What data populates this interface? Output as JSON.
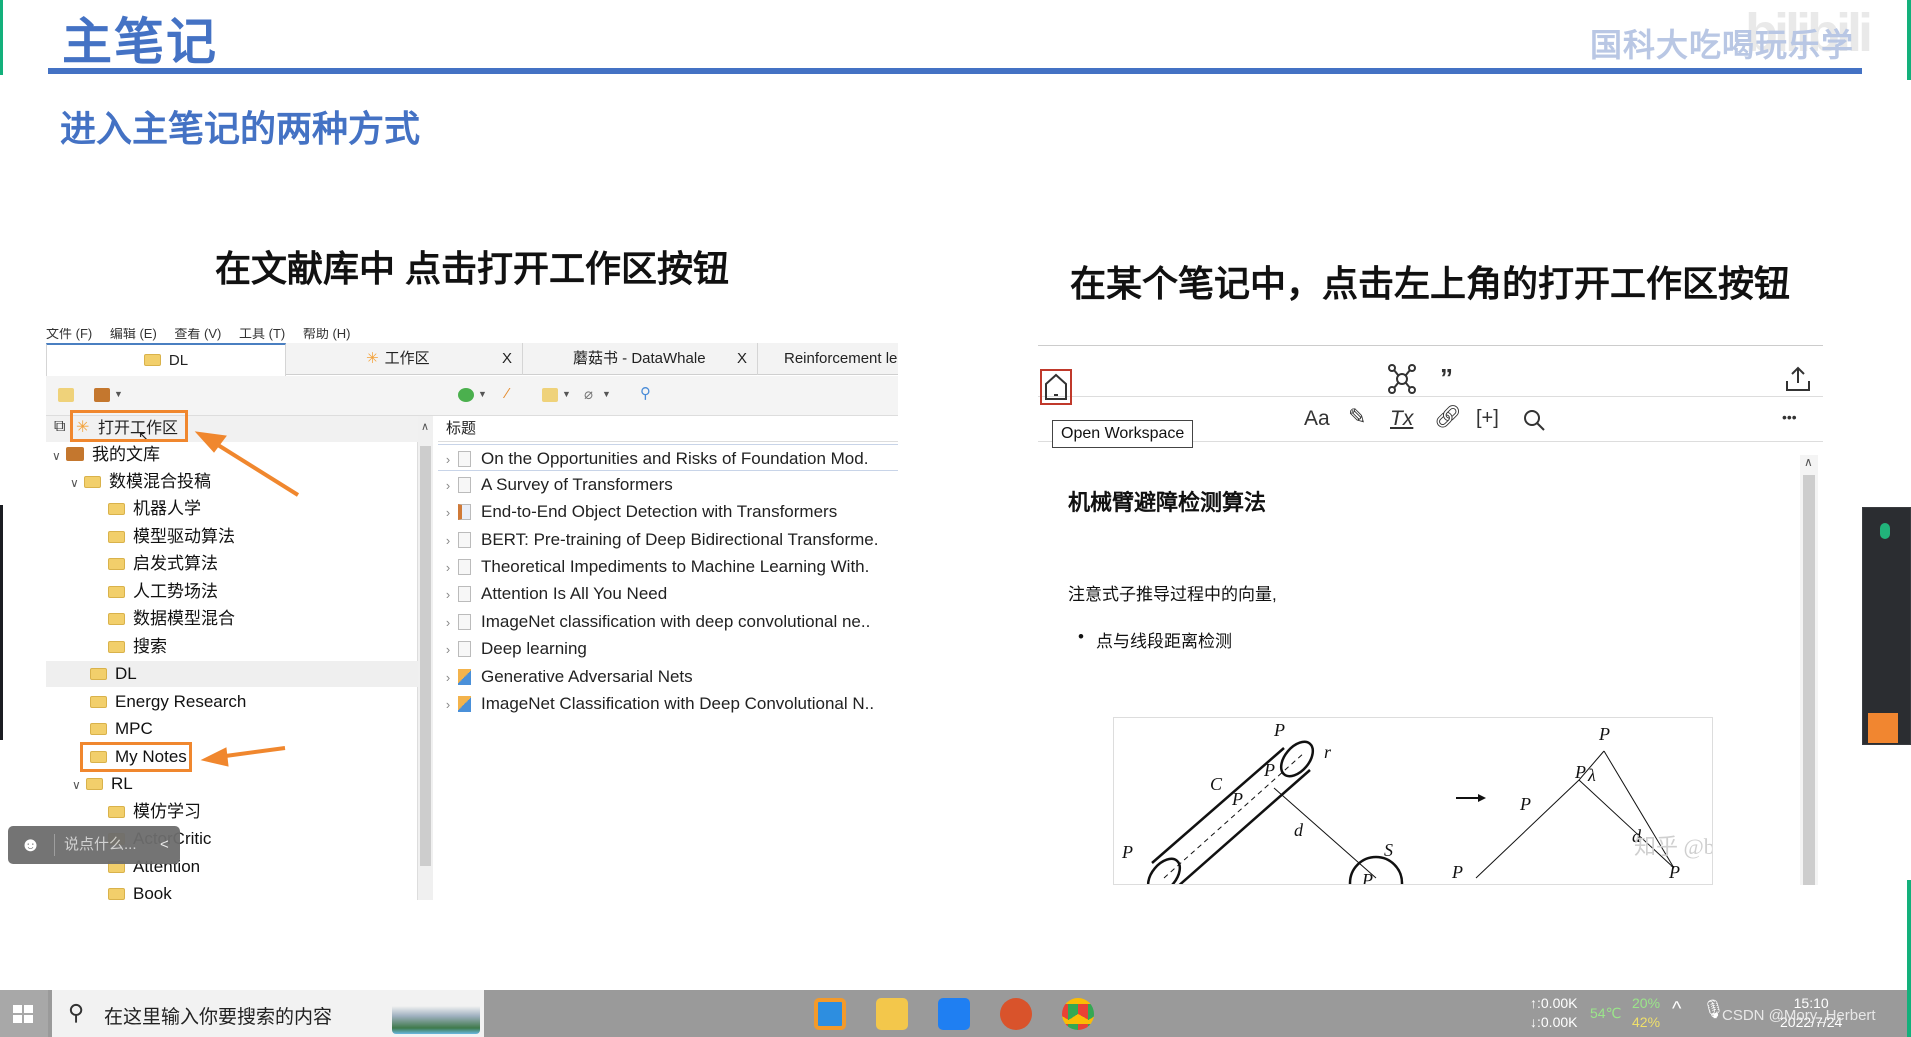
{
  "slide": {
    "title": "主笔记",
    "watermark": "国科大吃喝玩乐学",
    "watermark_logo": "bilibili",
    "subtitle": "进入主笔记的两种方式",
    "caption_left": "在文献库中 点击打开工作区按钮",
    "caption_right": "在某个笔记中，点击左上角的打开工作区按钮",
    "accent_color": "#4472c4",
    "annotation_color": "#f0872e",
    "arrow_color_right": "#e03a2f"
  },
  "zotero": {
    "menu": [
      "文件 (F)",
      "编辑 (E)",
      "查看 (V)",
      "工具 (T)",
      "帮助 (H)"
    ],
    "tabs": [
      {
        "label": "DL",
        "icon": "folder-icon",
        "closable": false,
        "active": true
      },
      {
        "label": "工作区",
        "icon": "workspace-icon",
        "closable": true
      },
      {
        "label": "蘑菇书 - DataWhale",
        "closable": true
      },
      {
        "label": "Reinforcement le",
        "closable": false
      }
    ],
    "close_glyph": "X",
    "open_workspace_label": "打开工作区",
    "tree": [
      {
        "label": "我的文库",
        "level": 0,
        "expanded": true,
        "type": "library"
      },
      {
        "label": "数模混合投稿",
        "level": 1,
        "expanded": true
      },
      {
        "label": "机器人学",
        "level": 2
      },
      {
        "label": "模型驱动算法",
        "level": 2
      },
      {
        "label": "启发式算法",
        "level": 2
      },
      {
        "label": "人工势场法",
        "level": 2
      },
      {
        "label": "数据模型混合",
        "level": 2
      },
      {
        "label": "搜索",
        "level": 2
      },
      {
        "label": "DL",
        "level": 1,
        "selected": true
      },
      {
        "label": "Energy Research",
        "level": 1
      },
      {
        "label": "MPC",
        "level": 1
      },
      {
        "label": "My Notes",
        "level": 1,
        "highlighted": true
      },
      {
        "label": "RL",
        "level": 1,
        "expanded": true
      },
      {
        "label": "模仿学习",
        "level": 2
      },
      {
        "label": "ActorCritic",
        "level": 2
      },
      {
        "label": "Attention",
        "level": 2
      },
      {
        "label": "Book",
        "level": 2
      }
    ],
    "column_header": "标题",
    "items": [
      {
        "title": "On the Opportunities and Risks of Foundation Mod.",
        "type": "doc"
      },
      {
        "title": "A Survey of Transformers",
        "type": "doc"
      },
      {
        "title": "End-to-End Object Detection with Transformers",
        "type": "pdf"
      },
      {
        "title": "BERT: Pre-training of Deep Bidirectional Transforme.",
        "type": "doc"
      },
      {
        "title": "Theoretical Impediments to Machine Learning With.",
        "type": "doc"
      },
      {
        "title": "Attention Is All You Need",
        "type": "doc"
      },
      {
        "title": "ImageNet classification with deep convolutional ne..",
        "type": "doc"
      },
      {
        "title": "Deep learning",
        "type": "doc"
      },
      {
        "title": "Generative Adversarial Nets",
        "type": "gan"
      },
      {
        "title": "ImageNet Classification with Deep Convolutional N..",
        "type": "gan"
      }
    ]
  },
  "note": {
    "tooltip": "Open Workspace",
    "toolbar_icons": [
      "home-icon",
      "graph-icon",
      "quote-icon",
      "share-icon",
      "font-icon",
      "highlight-icon",
      "clear-format-icon",
      "link-icon",
      "insert-citation-icon",
      "search-icon",
      "more-icon"
    ],
    "icon_glyphs": {
      "quote": "”",
      "font": "Aa",
      "clear": "Tx",
      "insert": "[+]",
      "more": "•••",
      "share": "⭱"
    },
    "title": "机械臂避障检测算法",
    "paragraph": "注意式子推导过程中的向量,",
    "bullet": "点与线段距离检测",
    "figure_labels": {
      "P1": "P",
      "P2": "P",
      "Pm": "P",
      "Pv": "P",
      "P0": "P",
      "C": "C",
      "S": "S",
      "rc": "r",
      "dmin": "d",
      "lambda": "λ"
    },
    "figure_watermark": "知乎 @be water"
  },
  "overlay": {
    "chat_placeholder": "说点什么...",
    "chat_collapse": "<"
  },
  "taskbar": {
    "search_placeholder": "在这里输入你要搜索的内容",
    "apps": [
      "vmware-icon",
      "file-explorer-icon",
      "app-icon",
      "powerpoint-icon",
      "chrome-icon"
    ],
    "net_up": "↑:0.00K",
    "net_down": "↓:0.00K",
    "temp": "54℃",
    "cpu": "20%",
    "mem": "42%",
    "time": "15:10",
    "date": "2022/7/24",
    "csdn_watermark": "CSDN @Mory_Herbert"
  }
}
